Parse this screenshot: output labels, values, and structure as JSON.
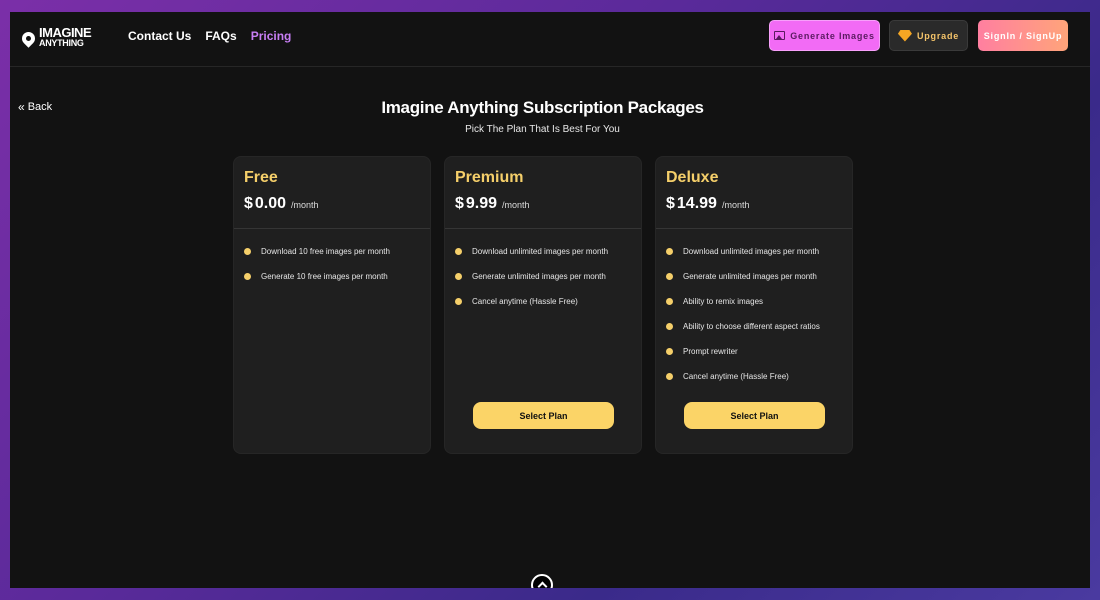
{
  "logo": {
    "line1": "IMAGINE",
    "line2": "ANYTHING"
  },
  "nav": {
    "contact": "Contact Us",
    "faqs": "FAQs",
    "pricing": "Pricing"
  },
  "header_buttons": {
    "generate": "Generate Images",
    "upgrade": "Upgrade",
    "signin": "SignIn / SignUp"
  },
  "back_label": "Back",
  "page": {
    "title": "Imagine Anything Subscription Packages",
    "subtitle": "Pick The Plan That Is Best For You"
  },
  "plans": [
    {
      "name": "Free",
      "currency": "$",
      "price": "0.00",
      "per": "/month",
      "features": [
        "Download 10 free images per month",
        "Generate 10 free images per month"
      ],
      "button": ""
    },
    {
      "name": "Premium",
      "currency": "$",
      "price": "9.99",
      "per": "/month",
      "features": [
        "Download unlimited images per month",
        "Generate unlimited images per month",
        "Cancel anytime (Hassle Free)"
      ],
      "button": "Select Plan"
    },
    {
      "name": "Deluxe",
      "currency": "$",
      "price": "14.99",
      "per": "/month",
      "features": [
        "Download unlimited images per month",
        "Generate unlimited images per month",
        "Ability to remix images",
        "Ability to choose different aspect ratios",
        "Prompt rewriter",
        "Cancel anytime (Hassle Free)"
      ],
      "button": "Select Plan"
    }
  ],
  "colors": {
    "accent": "#f5cf6a",
    "nav_active": "#c87ef5",
    "generate_btn": "#f26bf5",
    "button": "#fbd467"
  }
}
